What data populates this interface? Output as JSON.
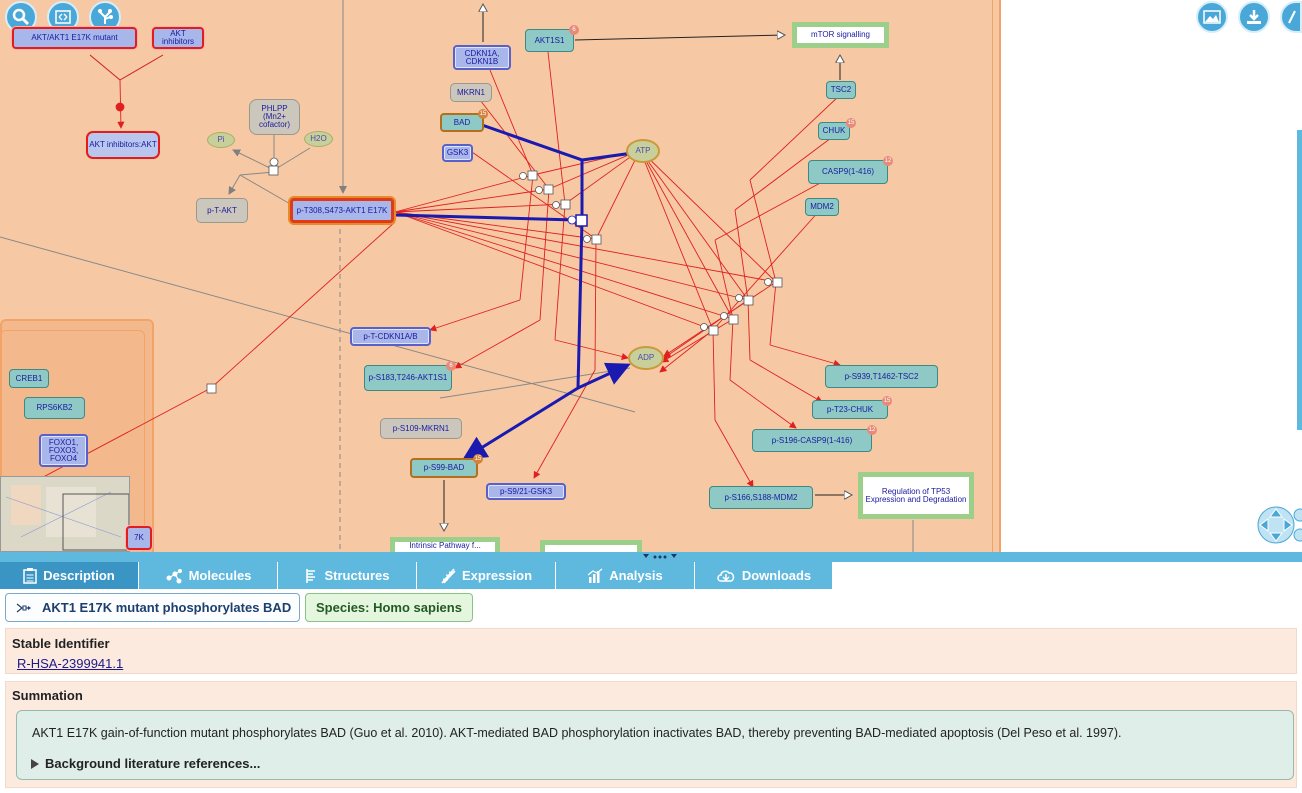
{
  "diagram": {
    "nodes": {
      "akt_mutant": "AKT/AKT1 E17K mutant",
      "akt_inhibitors": "AKT inhibitors",
      "akt_inh_complex": "AKT inhibitors:AKT",
      "phlpp": "PHLPP (Mn2+ cofactor)",
      "pi": "Pi",
      "h2o": "H2O",
      "p_t_akt": "p-T-AKT",
      "main": "p-T308,S473-AKT1 E17K",
      "cdkn1a": "CDKN1A, CDKN1B",
      "akt1s1": "AKT1S1",
      "mtor": "mTOR signalling",
      "mkrn1": "MKRN1",
      "bad": "BAD",
      "gsk3": "GSK3",
      "atp": "ATP",
      "tsc2": "TSC2",
      "chuk": "CHUK",
      "casp9": "CASP9(1-416)",
      "mdm2": "MDM2",
      "p_t_cdkn1ab": "p-T-CDKN1A/B",
      "p_akt1s1": "p-S183,T246-AKT1S1",
      "adp": "ADP",
      "p_tsc2": "p-S939,T1462-TSC2",
      "p_chuk": "p-T23-CHUK",
      "p_casp9": "p-S196-CASP9(1-416)",
      "p_mkrn1": "p-S109-MKRN1",
      "p_bad": "p-S99-BAD",
      "p_gsk3": "p-S9/21-GSK3",
      "p_mdm2": "p-S166,S188-MDM2",
      "tp53": "Regulation of TP53 Expression and Degradation",
      "creb1": "CREB1",
      "rps6kb2": "RPS6KB2",
      "foxo": "FOXO1, FOXO3, FOXO4",
      "cut_left": "7K",
      "cut_bottom": "Intrinsic Pathway f..."
    },
    "badges": {
      "akt1s1": "6",
      "bad": "15",
      "chuk": "15",
      "casp9": "12",
      "p_akt1s1": "6",
      "p_chuk": "15",
      "p_casp9": "12",
      "p_bad": "15"
    },
    "toolbar": {
      "search": "search-icon",
      "fit": "fit-screen-icon",
      "tree": "hierarchy-icon",
      "image": "image-export-icon",
      "download": "download-icon"
    }
  },
  "tabs": [
    {
      "label": "Description",
      "icon": "document-icon",
      "active": true
    },
    {
      "label": "Molecules",
      "icon": "molecules-icon",
      "active": false
    },
    {
      "label": "Structures",
      "icon": "structures-icon",
      "active": false
    },
    {
      "label": "Expression",
      "icon": "expression-icon",
      "active": false
    },
    {
      "label": "Analysis",
      "icon": "analysis-icon",
      "active": false
    },
    {
      "label": "Downloads",
      "icon": "downloads-icon",
      "active": false
    }
  ],
  "details": {
    "reaction_title": "AKT1 E17K mutant phosphorylates BAD",
    "species": "Species: Homo sapiens",
    "stable_id_label": "Stable Identifier",
    "stable_id": "R-HSA-2399941.1",
    "summation_label": "Summation",
    "summation_text": "AKT1 E17K gain-of-function mutant phosphorylates BAD (Guo et al. 2010). AKT-mediated BAD phosphorylation inactivates BAD, thereby preventing BAD-mediated apoptosis (Del Peso et al. 1997).",
    "literature_toggle": "Background literature references..."
  },
  "colors": {
    "compartment": "#f6c9a4",
    "compartment_border": "#f2a468",
    "tab_blue": "#5fb8dd",
    "tab_active": "#3a95c5",
    "reaction_red": "#e02020",
    "selected_blue": "#1a1ab0"
  }
}
